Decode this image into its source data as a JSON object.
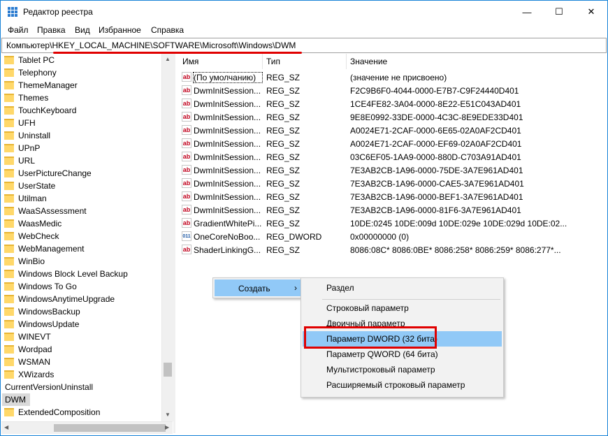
{
  "window": {
    "title": "Редактор реестра",
    "controls": {
      "minimize": "—",
      "maximize": "☐",
      "close": "✕"
    }
  },
  "menu": [
    "Файл",
    "Правка",
    "Вид",
    "Избранное",
    "Справка"
  ],
  "address": "Компьютер\\HKEY_LOCAL_MACHINE\\SOFTWARE\\Microsoft\\Windows\\DWM",
  "tree": {
    "items": [
      {
        "label": "Tablet PC",
        "folder": true
      },
      {
        "label": "Telephony",
        "folder": true
      },
      {
        "label": "ThemeManager",
        "folder": true
      },
      {
        "label": "Themes",
        "folder": true
      },
      {
        "label": "TouchKeyboard",
        "folder": true
      },
      {
        "label": "UFH",
        "folder": true
      },
      {
        "label": "Uninstall",
        "folder": true
      },
      {
        "label": "UPnP",
        "folder": true
      },
      {
        "label": "URL",
        "folder": true
      },
      {
        "label": "UserPictureChange",
        "folder": true
      },
      {
        "label": "UserState",
        "folder": true
      },
      {
        "label": "Utilman",
        "folder": true
      },
      {
        "label": "WaaSAssessment",
        "folder": true
      },
      {
        "label": "WaasMedic",
        "folder": true
      },
      {
        "label": "WebCheck",
        "folder": true
      },
      {
        "label": "WebManagement",
        "folder": true
      },
      {
        "label": "WinBio",
        "folder": true
      },
      {
        "label": "Windows Block Level Backup",
        "folder": true
      },
      {
        "label": "Windows To Go",
        "folder": true
      },
      {
        "label": "WindowsAnytimeUpgrade",
        "folder": true
      },
      {
        "label": "WindowsBackup",
        "folder": true
      },
      {
        "label": "WindowsUpdate",
        "folder": true
      },
      {
        "label": "WINEVT",
        "folder": true
      },
      {
        "label": "Wordpad",
        "folder": true
      },
      {
        "label": "WSMAN",
        "folder": true
      },
      {
        "label": "XWizards",
        "folder": true
      },
      {
        "label": "CurrentVersionUninstall",
        "folder": false
      },
      {
        "label": "DWM",
        "folder": false,
        "selected": true
      },
      {
        "label": "ExtendedComposition",
        "folder": true
      }
    ]
  },
  "list": {
    "headers": [
      "Имя",
      "Тип",
      "Значение"
    ],
    "rows": [
      {
        "icon": "ab",
        "name": "(По умолчанию)",
        "type": "REG_SZ",
        "value": "(значение не присвоено)"
      },
      {
        "icon": "ab",
        "name": "DwmInitSession...",
        "type": "REG_SZ",
        "value": "F2C9B6F0-4044-0000-E7B7-C9F24440D401"
      },
      {
        "icon": "ab",
        "name": "DwmInitSession...",
        "type": "REG_SZ",
        "value": "1CE4FE82-3A04-0000-8E22-E51C043AD401"
      },
      {
        "icon": "ab",
        "name": "DwmInitSession...",
        "type": "REG_SZ",
        "value": "9E8E0992-33DE-0000-4C3C-8E9EDE33D401"
      },
      {
        "icon": "ab",
        "name": "DwmInitSession...",
        "type": "REG_SZ",
        "value": "A0024E71-2CAF-0000-6E65-02A0AF2CD401"
      },
      {
        "icon": "ab",
        "name": "DwmInitSession...",
        "type": "REG_SZ",
        "value": "A0024E71-2CAF-0000-EF69-02A0AF2CD401"
      },
      {
        "icon": "ab",
        "name": "DwmInitSession...",
        "type": "REG_SZ",
        "value": "03C6EF05-1AA9-0000-880D-C703A91AD401"
      },
      {
        "icon": "ab",
        "name": "DwmInitSession...",
        "type": "REG_SZ",
        "value": "7E3AB2CB-1A96-0000-75DE-3A7E961AD401"
      },
      {
        "icon": "ab",
        "name": "DwmInitSession...",
        "type": "REG_SZ",
        "value": "7E3AB2CB-1A96-0000-CAE5-3A7E961AD401"
      },
      {
        "icon": "ab",
        "name": "DwmInitSession...",
        "type": "REG_SZ",
        "value": "7E3AB2CB-1A96-0000-BEF1-3A7E961AD401"
      },
      {
        "icon": "ab",
        "name": "DwmInitSession...",
        "type": "REG_SZ",
        "value": "7E3AB2CB-1A96-0000-81F6-3A7E961AD401"
      },
      {
        "icon": "ab",
        "name": "GradientWhitePi...",
        "type": "REG_SZ",
        "value": "10DE:0245 10DE:009d 10DE:029e 10DE:029d 10DE:02..."
      },
      {
        "icon": "dw",
        "name": "OneCoreNoBoo...",
        "type": "REG_DWORD",
        "value": "0x00000000 (0)"
      },
      {
        "icon": "ab",
        "name": "ShaderLinkingG...",
        "type": "REG_SZ",
        "value": "8086:08C* 8086:0BE* 8086:258* 8086:259* 8086:277*..."
      }
    ]
  },
  "context_menu": {
    "create_label": "Создать",
    "chevron": "›",
    "submenu": [
      "Раздел",
      "Строковый параметр",
      "Двоичный параметр",
      "Параметр DWORD (32 бита)",
      "Параметр QWORD (64 бита)",
      "Мультистроковый параметр",
      "Расширяемый строковый параметр"
    ]
  },
  "colors": {
    "highlight": "#91c9f7",
    "annotation_red": "#e00000",
    "accent": "#1883d7"
  }
}
